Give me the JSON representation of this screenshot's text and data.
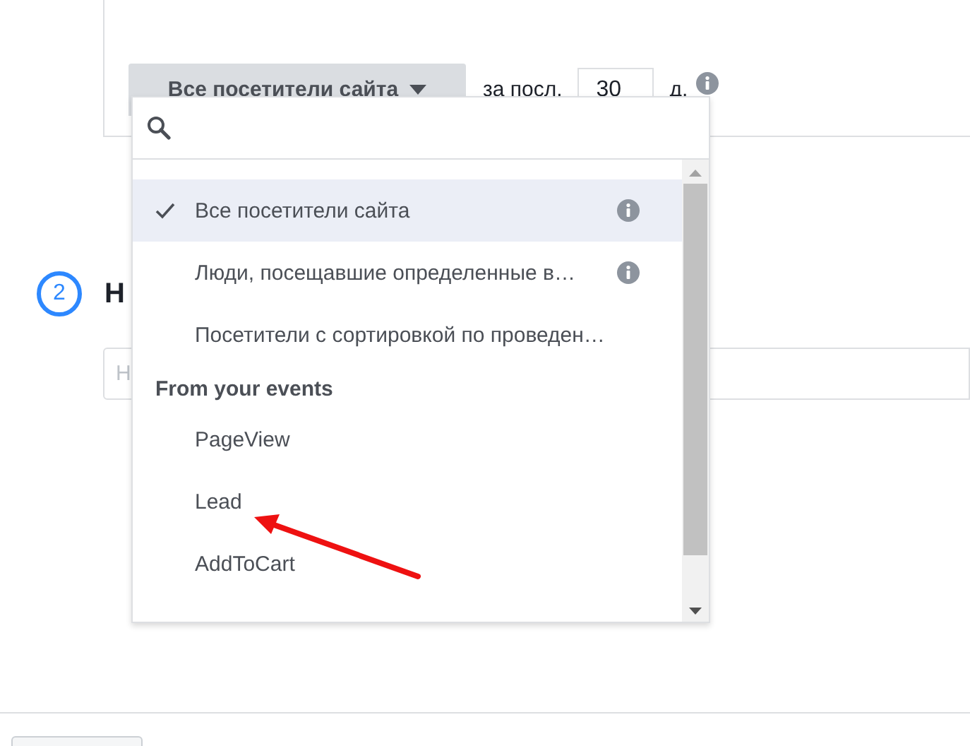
{
  "audience_button": {
    "label": "Все посетители сайта"
  },
  "period": {
    "prefix": "за посл.",
    "value": "30",
    "suffix": "д."
  },
  "dropdown": {
    "items": [
      {
        "kind": "option",
        "label": "Все посетители сайта",
        "selected": true,
        "info": true
      },
      {
        "kind": "option",
        "label": "Люди, посещавшие определенные в…",
        "selected": false,
        "info": true
      },
      {
        "kind": "option",
        "label": "Посетители с сортировкой по проведен…",
        "selected": false,
        "info": false
      },
      {
        "kind": "header",
        "label": "From your events"
      },
      {
        "kind": "option",
        "label": "PageView",
        "selected": false,
        "info": false
      },
      {
        "kind": "option",
        "label": "Lead",
        "selected": false,
        "info": false
      },
      {
        "kind": "option",
        "label": "AddToCart",
        "selected": false,
        "info": false
      }
    ]
  },
  "step": {
    "number": "2",
    "title": "Н"
  },
  "name_field": {
    "placeholder": "Н"
  }
}
